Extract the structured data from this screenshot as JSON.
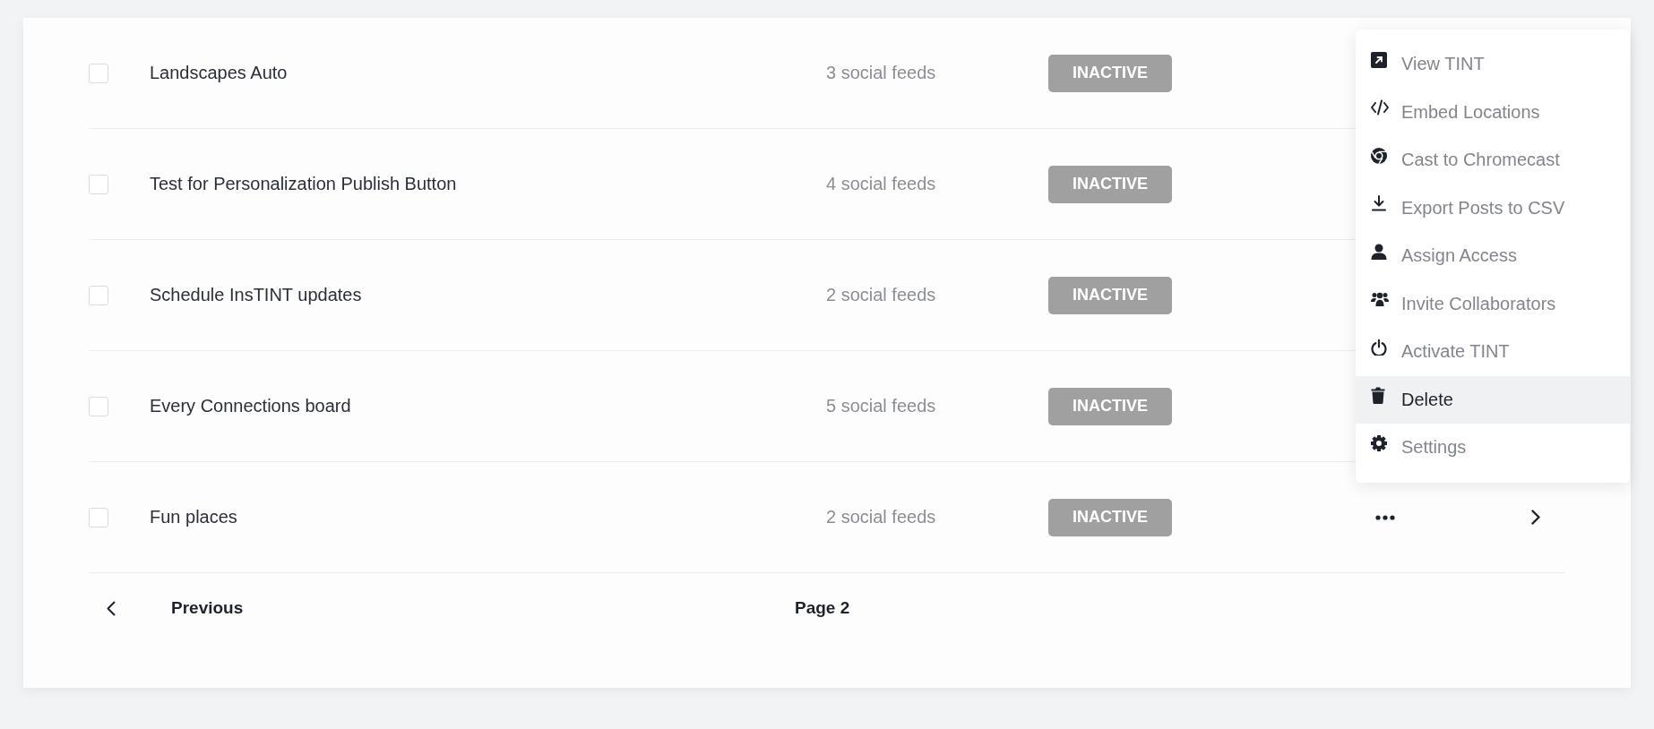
{
  "table": {
    "rows": [
      {
        "checked": false,
        "name": "Landscapes Auto",
        "feeds": "3 social feeds",
        "status": "INACTIVE"
      },
      {
        "checked": false,
        "name": "Test for Personalization Publish Button",
        "feeds": "4 social feeds",
        "status": "INACTIVE"
      },
      {
        "checked": false,
        "name": "Schedule InsTINT updates",
        "feeds": "2 social feeds",
        "status": "INACTIVE"
      },
      {
        "checked": false,
        "name": "Every Connections board",
        "feeds": "5 social feeds",
        "status": "INACTIVE"
      },
      {
        "checked": false,
        "name": "Fun places",
        "feeds": "2 social feeds",
        "status": "INACTIVE"
      }
    ]
  },
  "action_menu": {
    "items": [
      {
        "label": "View TINT",
        "highlighted": false
      },
      {
        "label": "Embed Locations",
        "highlighted": false
      },
      {
        "label": "Cast to Chromecast",
        "highlighted": false
      },
      {
        "label": "Export Posts to CSV",
        "highlighted": false
      },
      {
        "label": "Assign Access",
        "highlighted": false
      },
      {
        "label": "Invite Collaborators",
        "highlighted": false
      },
      {
        "label": "Activate TINT",
        "highlighted": false
      },
      {
        "label": "Delete",
        "highlighted": true
      },
      {
        "label": "Settings",
        "highlighted": false
      }
    ]
  },
  "pagination": {
    "previous": "Previous",
    "page": "Page 2"
  }
}
